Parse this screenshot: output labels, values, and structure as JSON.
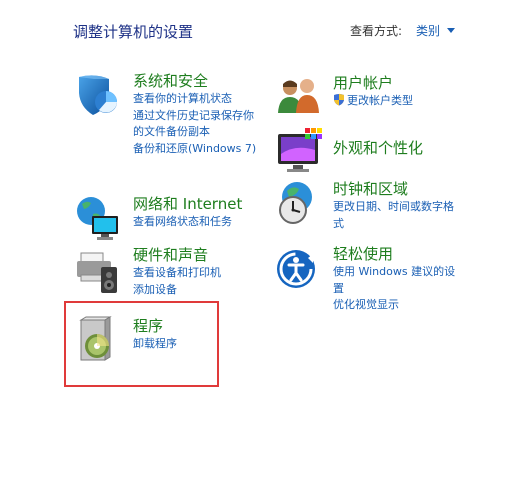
{
  "page": {
    "title": "调整计算机的设置",
    "view_by_label": "查看方式:",
    "view_by_value": "类别"
  },
  "categories": [
    {
      "title": "系统和安全",
      "icon": "shield-icon",
      "links": [
        "查看你的计算机状态",
        "通过文件历史记录保存你的文件备份副本",
        "备份和还原(Windows 7)"
      ]
    },
    {
      "title": "用户帐户",
      "icon": "users-icon",
      "links": [
        "更改帐户类型"
      ]
    },
    {
      "title": "外观和个性化",
      "icon": "monitor-palette-icon",
      "links": []
    },
    {
      "title": "网络和 Internet",
      "icon": "globe-network-icon",
      "links": [
        "查看网络状态和任务"
      ]
    },
    {
      "title": "时钟和区域",
      "icon": "clock-globe-icon",
      "links": [
        "更改日期、时间或数字格式"
      ]
    },
    {
      "title": "硬件和声音",
      "icon": "printer-speaker-icon",
      "links": [
        "查看设备和打印机",
        "添加设备"
      ]
    },
    {
      "title": "轻松使用",
      "icon": "ease-of-access-icon",
      "links": [
        "使用 Windows 建议的设置",
        "优化视觉显示"
      ]
    },
    {
      "title": "程序",
      "icon": "programs-disc-icon",
      "links": [
        "卸载程序"
      ]
    }
  ],
  "colors": {
    "title_blue": "#1e3287",
    "category_green": "#1e7d1e",
    "link_blue": "#1a5fb4",
    "highlight_red": "#e03a3a"
  }
}
